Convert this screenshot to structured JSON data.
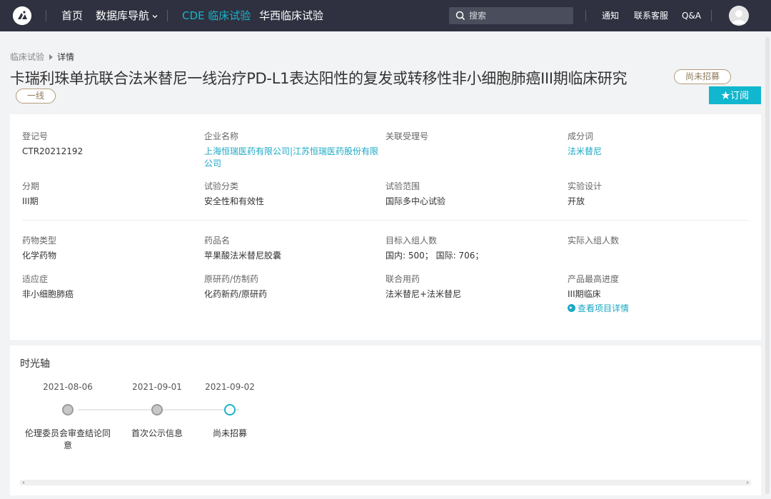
{
  "nav": {
    "home": "首页",
    "database_nav": "数据库导航",
    "cde": "CDE 临床试验",
    "huaxi": "华西临床试验",
    "search_placeholder": "搜索",
    "notify": "通知",
    "support": "联系客服",
    "qa": "Q&A"
  },
  "breadcrumb": {
    "parent": "临床试验",
    "current": "详情"
  },
  "title": "卡瑞利珠单抗联合法米替尼一线治疗PD-L1表达阳性的复发或转移性非小细胞肺癌III期临床研究",
  "tags": [
    "尚未招募",
    "一线"
  ],
  "subscribe_label": "★订阅",
  "info": {
    "reg_no": {
      "label": "登记号",
      "value": "CTR20212192"
    },
    "company": {
      "label": "企业名称",
      "value": "上海恒瑞医药有限公司|江苏恒瑞医药股份有限公司"
    },
    "related_no": {
      "label": "关联受理号",
      "value": ""
    },
    "ingredient": {
      "label": "成分词",
      "value": "法米替尼"
    },
    "phase": {
      "label": "分期",
      "value": "III期"
    },
    "trial_type": {
      "label": "试验分类",
      "value": "安全性和有效性"
    },
    "scope": {
      "label": "试验范围",
      "value": "国际多中心试验"
    },
    "design": {
      "label": "实验设计",
      "value": "开放"
    },
    "drug_type": {
      "label": "药物类型",
      "value": "化学药物"
    },
    "drug_name": {
      "label": "药品名",
      "value": "苹果酸法米替尼胶囊"
    },
    "target_enroll": {
      "label": "目标入组人数",
      "value": "国内: 500； 国际: 706；"
    },
    "actual_enroll": {
      "label": "实际入组人数",
      "value": ""
    },
    "indication": {
      "label": "适应症",
      "value": "非小细胞肺癌"
    },
    "origin": {
      "label": "原研药/仿制药",
      "value": "化药新药/原研药"
    },
    "combo": {
      "label": "联合用药",
      "value": "法米替尼+法米替尼"
    },
    "progress": {
      "label": "产品最高进度",
      "value": "III期临床",
      "link": "查看项目详情"
    }
  },
  "timeline": {
    "title": "时光轴",
    "events": [
      {
        "date": "2021-08-06",
        "label": "伦理委员会审查结论同意"
      },
      {
        "date": "2021-09-01",
        "label": "首次公示信息"
      },
      {
        "date": "2021-09-02",
        "label": "尚未招募"
      }
    ]
  },
  "colors": {
    "accent": "#1ab3c9",
    "topbar": "#2f3140",
    "tag_border": "#b39c7d"
  }
}
